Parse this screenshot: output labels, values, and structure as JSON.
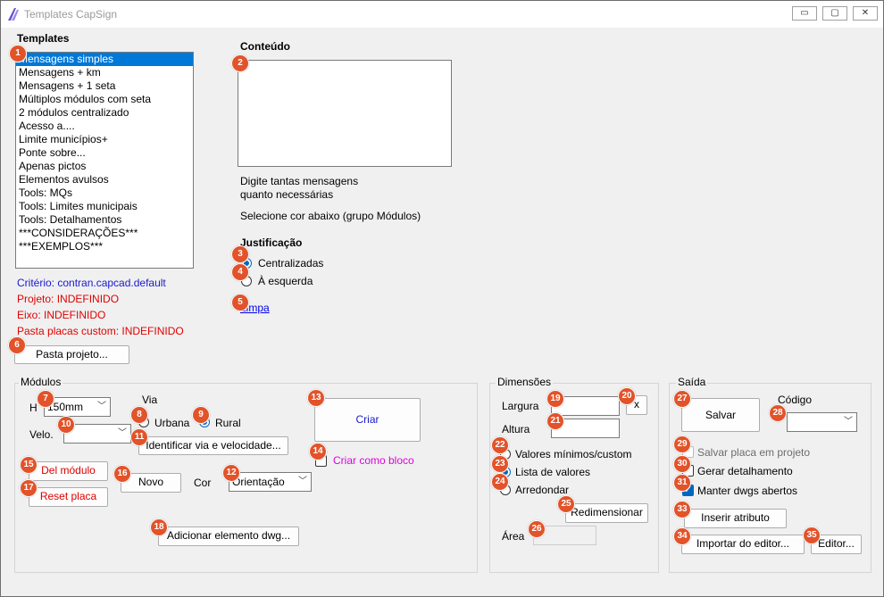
{
  "window": {
    "title": "Templates CapSign",
    "minimize": "▭",
    "maximize": "▢",
    "close": "✕"
  },
  "templates": {
    "heading": "Templates",
    "items": [
      "Mensagens simples",
      "Mensagens + km",
      "Mensagens + 1 seta",
      "Múltiplos módulos com seta",
      "2 módulos centralizado",
      "Acesso a....",
      "Limite municípios+",
      "Ponte sobre...",
      "Apenas pictos",
      "Elementos avulsos",
      "Tools: MQs",
      "Tools: Limites municipais",
      "Tools: Detalhamentos",
      "***CONSIDERAÇÕES***",
      "***EXEMPLOS***"
    ],
    "selected_index": 0
  },
  "info": {
    "criterio": "Critério: contran.capcad.default",
    "projeto": "Projeto: INDEFINIDO",
    "eixo": "Eixo: INDEFINIDO",
    "pasta_placas": "Pasta placas custom: INDEFINIDO",
    "pasta_projeto_btn": "Pasta projeto..."
  },
  "conteudo": {
    "heading": "Conteúdo",
    "text_value": "",
    "hint1": "Digite tantas mensagens",
    "hint2": "quanto necessárias",
    "hint3": "Selecione cor abaixo (grupo Módulos)"
  },
  "justificacao": {
    "heading": "Justificação",
    "opt1": "Centralizadas",
    "opt2": "À esquerda",
    "selected": "Centralizadas",
    "limpa": "Limpa"
  },
  "modulos": {
    "group": "Módulos",
    "h_label": "H",
    "h_value": "150mm",
    "via_label": "Via",
    "urbana": "Urbana",
    "rural": "Rural",
    "via_selected": "Rural",
    "velo_label": "Velo.",
    "velo_value": "",
    "identificar_btn": "Identificar via e velocidade...",
    "criar_btn": "Criar",
    "criar_bloco": "Criar como bloco",
    "del_modulo_btn": "Del módulo",
    "reset_placa_btn": "Reset placa",
    "novo_btn": "Novo",
    "cor_label": "Cor",
    "cor_value": "Orientação",
    "adicionar_btn": "Adicionar elemento dwg..."
  },
  "dimensoes": {
    "group": "Dimensões",
    "largura_label": "Largura",
    "largura_value": "",
    "x_btn": "x",
    "altura_label": "Altura",
    "altura_value": "",
    "opt_minimos": "Valores mínimos/custom",
    "opt_lista": "Lista de valores",
    "opt_arredondar": "Arredondar",
    "selected": "Lista de valores",
    "redimensionar_btn": "Redimensionar",
    "area_label": "Área",
    "area_value": ""
  },
  "saida": {
    "group": "Saída",
    "salvar_btn": "Salvar",
    "codigo_label": "Código",
    "codigo_value": "",
    "salvar_placa": "Salvar placa em projeto",
    "gerar_detalhamento": "Gerar detalhamento",
    "manter_dwgs": "Manter dwgs abertos",
    "manter_checked": true,
    "inserir_btn": "Inserir atributo",
    "importar_btn": "Importar do editor...",
    "editor_btn": "Editor..."
  },
  "badges": [
    "1",
    "2",
    "3",
    "4",
    "5",
    "6",
    "7",
    "8",
    "9",
    "10",
    "11",
    "12",
    "13",
    "14",
    "15",
    "16",
    "17",
    "18",
    "19",
    "20",
    "21",
    "22",
    "23",
    "24",
    "25",
    "26",
    "27",
    "28",
    "29",
    "30",
    "31",
    "32",
    "33",
    "34",
    "35"
  ],
  "colors": {
    "badge": "#e2532a",
    "selection": "#0078d7",
    "red_text": "#e00000",
    "blue_text": "#1a1acd",
    "magenta_text": "#e000e0",
    "radio_checked": "#0067c0"
  }
}
